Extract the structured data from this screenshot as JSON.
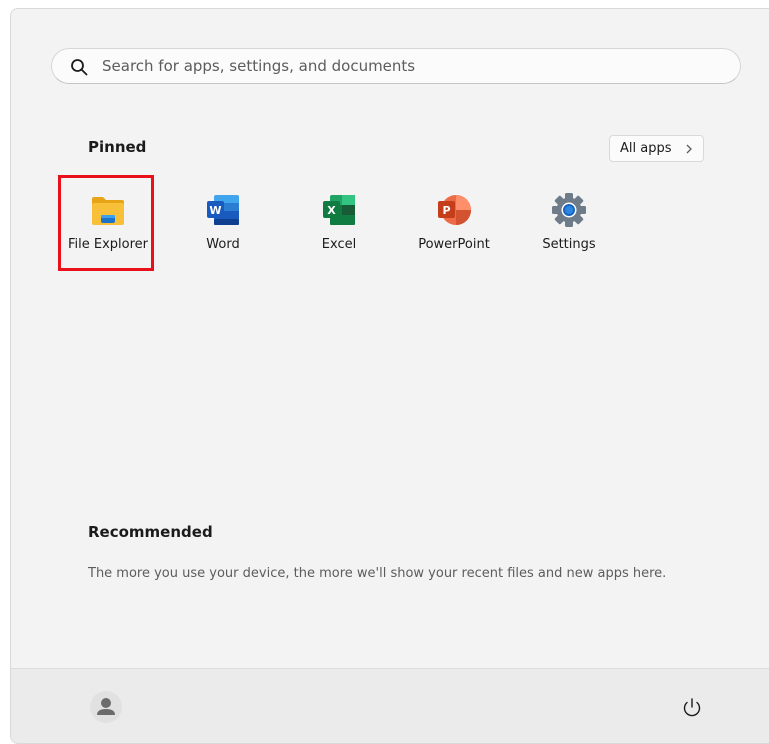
{
  "search": {
    "placeholder": "Search for apps, settings, and documents",
    "icon": "search-icon"
  },
  "pinned": {
    "title": "Pinned",
    "all_apps_label": "All apps",
    "apps": [
      {
        "label": "File Explorer",
        "icon": "file-explorer-icon",
        "highlighted": true
      },
      {
        "label": "Word",
        "icon": "word-icon"
      },
      {
        "label": "Excel",
        "icon": "excel-icon"
      },
      {
        "label": "PowerPoint",
        "icon": "powerpoint-icon"
      },
      {
        "label": "Settings",
        "icon": "settings-gear-icon"
      }
    ]
  },
  "recommended": {
    "title": "Recommended",
    "empty_text": "The more you use your device, the more we'll show your recent files and new apps here."
  },
  "footer": {
    "user_icon": "user-avatar-icon",
    "power_icon": "power-icon"
  },
  "colors": {
    "highlight": "#e8101a",
    "word": "#185abd",
    "excel": "#107c41",
    "powerpoint": "#c43e1c",
    "folder": "#f8c038"
  }
}
